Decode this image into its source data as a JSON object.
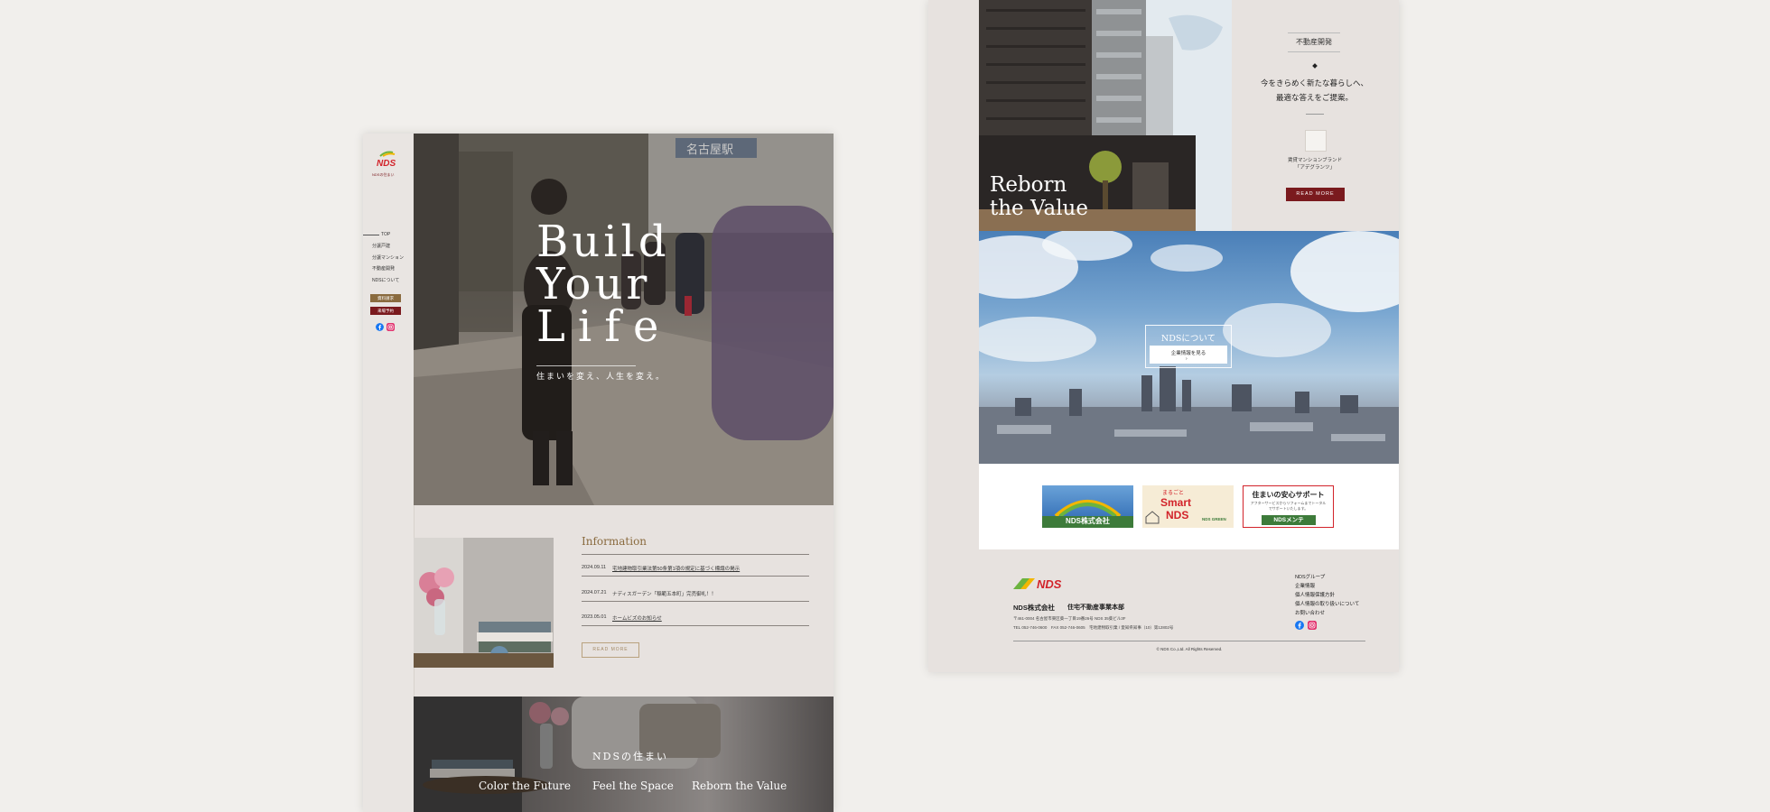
{
  "left_page": {
    "brand": {
      "logo_text": "NDS",
      "logo_sub": "NDSの住まい"
    },
    "nav": [
      "TOP",
      "分譲戸建",
      "分譲マンション",
      "不動産開発",
      "NDSについて"
    ],
    "side_buttons": [
      "資料請求",
      "来場予約"
    ],
    "hero": {
      "line1": "Build",
      "line2": "Your",
      "line3": "Life",
      "tagline": "住まいを変え、人生を変え。",
      "station_sign": "名古屋駅"
    },
    "info": {
      "heading": "Information",
      "items": [
        {
          "date": "2024.09.11",
          "title": "宅地建物取引業法第50条第1項の規定に基づく標識の掲示"
        },
        {
          "date": "2024.07.21",
          "title": "ナディスガーデン「稲範五本町」完売御礼！！"
        },
        {
          "date": "2023.05.01",
          "title": "ホームビズのお知らせ"
        }
      ],
      "read_more": "READ MORE"
    },
    "house": {
      "title": "NDSの住まい",
      "links": [
        "Color the Future",
        "Feel the Space",
        "Reborn the Value"
      ]
    }
  },
  "right_page": {
    "building": {
      "caption_line1": "Reborn",
      "caption_line2": "the Value"
    },
    "development": {
      "label": "不動産開発",
      "copy_line1": "今をきらめく新たな暮らしへ、",
      "copy_line2": "最適な答えをご提案。",
      "brand_line1": "賃貸マンションブランド",
      "brand_line2": "「アデグランツ」",
      "read_more": "READ MORE"
    },
    "about": {
      "title": "NDSについて",
      "sub": "企業情報を見る"
    },
    "banners": {
      "b1": "NDS株式会社",
      "b2_top": "まるごと",
      "b2_mid": "Smart",
      "b2_bot": "NDS",
      "b2_small": "NDS GREEN",
      "b3_title": "住まいの安心サポート",
      "b3_sub": "アフターサービスからリフォームまでトータルでサポートいたします。",
      "b3_logo": "NDSメンテ"
    },
    "footer": {
      "company": "NDS株式会社",
      "division": "住宅不動産事業本部",
      "address": "〒461-0004 名古屋市東区葵一丁目19番26号 NDS 35葵ビル3F",
      "tel": "TEL 052-746-0600　FAX 052-746-0605　宅地建物取引業 / 愛知県知事（10）第12802号",
      "links": [
        "NDSグループ",
        "企業情報",
        "個人情報保護方針",
        "個人情報の取り扱いについて",
        "お問い合わせ"
      ],
      "copyright": "© NDS Co.,Ltd. All Rights Reserved."
    }
  },
  "colors": {
    "maroon": "#7a1a1e",
    "gold_brown": "#8a6b3f",
    "brand_red": "#d2232a",
    "brand_green": "#6cb33f"
  }
}
